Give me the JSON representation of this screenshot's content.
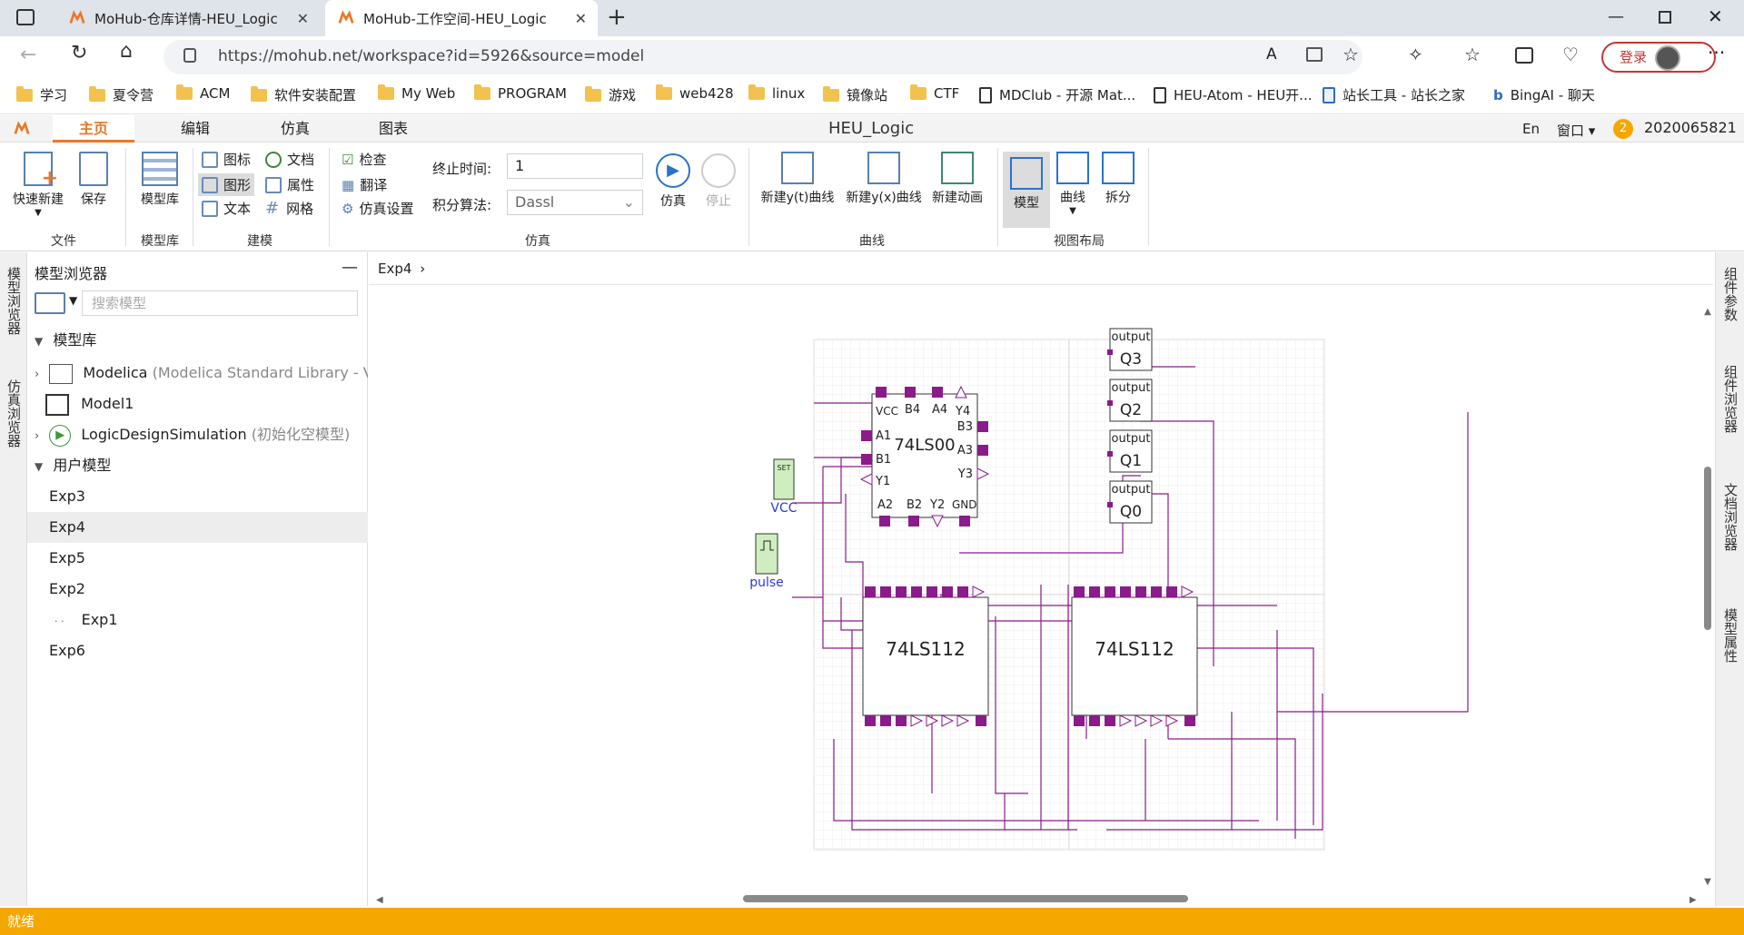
{
  "browser": {
    "tabs": [
      {
        "label": "MoHub-仓库详情-HEU_Logic"
      },
      {
        "label": "MoHub-工作空间-HEU_Logic"
      }
    ],
    "url": "https://mohub.net/workspace?id=5926&source=model",
    "login_label": "登录",
    "bookmarks": [
      {
        "label": "学习",
        "icon": "folder-icon"
      },
      {
        "label": "夏令营",
        "icon": "folder-icon"
      },
      {
        "label": "ACM",
        "icon": "folder-icon"
      },
      {
        "label": "软件安装配置",
        "icon": "folder-icon"
      },
      {
        "label": "My Web",
        "icon": "folder-icon"
      },
      {
        "label": "PROGRAM",
        "icon": "folder-icon"
      },
      {
        "label": "游戏",
        "icon": "folder-icon"
      },
      {
        "label": "web428",
        "icon": "folder-icon"
      },
      {
        "label": "linux",
        "icon": "folder-icon"
      },
      {
        "label": "镜像站",
        "icon": "folder-icon"
      },
      {
        "label": "CTF",
        "icon": "folder-icon"
      },
      {
        "label": "MDClub - 开源 Mat...",
        "icon": "page-icon"
      },
      {
        "label": "HEU-Atom - HEU开...",
        "icon": "page-icon"
      },
      {
        "label": "站长工具 - 站长之家",
        "icon": "tool-icon"
      },
      {
        "label": "BingAI - 聊天",
        "icon": "bing-icon"
      }
    ]
  },
  "app": {
    "title": "HEU_Logic",
    "tabs": [
      "主页",
      "编辑",
      "仿真",
      "图表"
    ],
    "lang": "En",
    "window_menu": "窗口",
    "notif_count": "2",
    "user_id": "2020065821"
  },
  "ribbon": {
    "file": {
      "new_label": "快速新建",
      "save_label": "保存",
      "group": "文件"
    },
    "library": {
      "label": "模型库",
      "group": "模型库"
    },
    "modeling": {
      "icon_label": "图标",
      "doc_label": "文档",
      "shape_label": "图形",
      "prop_label": "属性",
      "text_label": "文本",
      "grid_label": "网格",
      "group": "建模"
    },
    "sim": {
      "check_label": "检查",
      "translate_label": "翻译",
      "settings_label": "仿真设置",
      "end_time_label": "终止时间:",
      "end_time_value": "1",
      "algo_label": "积分算法:",
      "algo_value": "Dassl",
      "run_label": "仿真",
      "stop_label": "停止",
      "group": "仿真"
    },
    "curves": {
      "yt_label": "新建y(t)曲线",
      "yx_label": "新建y(x)曲线",
      "anim_label": "新建动画",
      "group": "曲线"
    },
    "layout": {
      "model_label": "模型",
      "curve_label": "曲线",
      "split_label": "拆分",
      "group": "视图布局"
    }
  },
  "left": {
    "strip_top": "模型浏览器",
    "strip_bottom": "仿真浏览器",
    "title": "模型浏览器",
    "search_placeholder": "搜索模型",
    "lib_header": "模型库",
    "lib_items": [
      {
        "name": "Modelica",
        "desc": "(Modelica Standard Library - Ve..."
      },
      {
        "name": "Model1",
        "desc": ""
      },
      {
        "name": "LogicDesignSimulation",
        "desc": "(初始化空模型)"
      }
    ],
    "user_header": "用户模型",
    "user_items": [
      "Exp3",
      "Exp4",
      "Exp5",
      "Exp2",
      "Exp1",
      "Exp6"
    ]
  },
  "canvas": {
    "breadcrumb": "Exp4",
    "outputs": [
      {
        "header": "output",
        "name": "Q3"
      },
      {
        "header": "output",
        "name": "Q2"
      },
      {
        "header": "output",
        "name": "Q1"
      },
      {
        "header": "output",
        "name": "Q0"
      }
    ],
    "chip_top": {
      "name": "74LS00",
      "pins_top": [
        "VCC",
        "B4",
        "A4",
        "Y4"
      ],
      "pins_left": [
        "A1",
        "B1",
        "Y1"
      ],
      "pins_right": [
        "B3",
        "A3",
        "Y3"
      ],
      "pins_bottom": [
        "A2",
        "B2",
        "Y2",
        "GND"
      ]
    },
    "chip_left": {
      "name": "74LS112"
    },
    "chip_right": {
      "name": "74LS112"
    },
    "source_set": {
      "badge": "SET",
      "label": "VCC"
    },
    "source_pulse": {
      "label": "pulse"
    }
  },
  "right": {
    "items": [
      "组件参数",
      "组件浏览器",
      "文档浏览器",
      "模型属性"
    ]
  },
  "status": {
    "text": "就绪"
  },
  "colors": {
    "accent": "#e8782a",
    "wire": "#8b1a8b",
    "status_bg": "#f5a700"
  }
}
